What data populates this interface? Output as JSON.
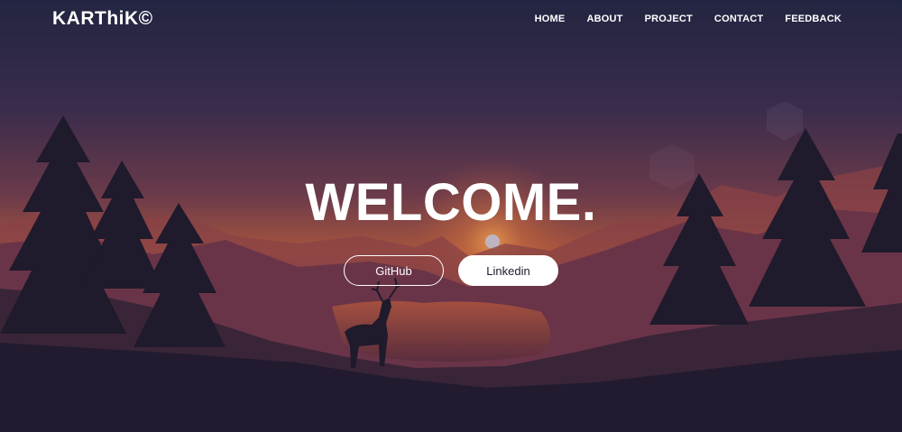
{
  "brand": {
    "name": "KARThiK©"
  },
  "nav": {
    "items": [
      {
        "label": "HOME"
      },
      {
        "label": "ABOUT"
      },
      {
        "label": "PROJECT"
      },
      {
        "label": "CONTACT"
      },
      {
        "label": "FEEDBACK"
      }
    ]
  },
  "hero": {
    "title": "WELCOME.",
    "buttons": {
      "github": "GitHub",
      "linkedin": "Linkedin"
    }
  },
  "colors": {
    "sky_top": "#222541",
    "sky_glow": "#b3563a",
    "mountains": "#6a3448",
    "foreground": "#221b30",
    "button_text_dark": "#1e1b2e"
  }
}
